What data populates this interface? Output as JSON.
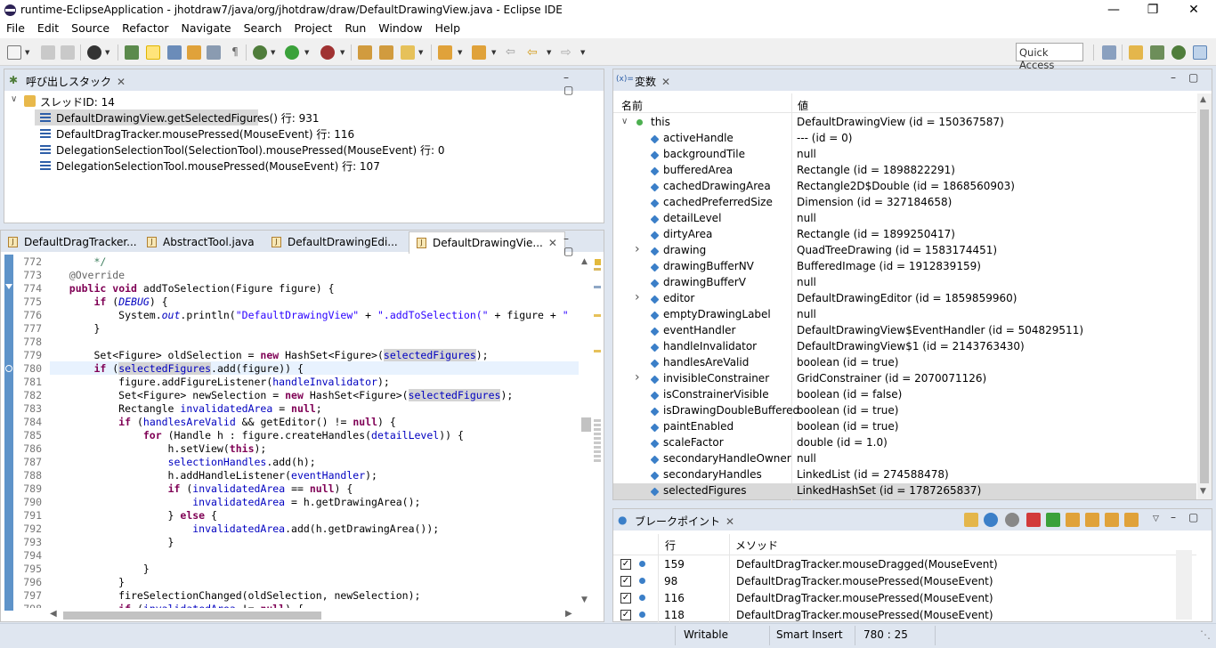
{
  "window": {
    "title": "runtime-EclipseApplication - jhotdraw7/java/org/jhotdraw/draw/DefaultDrawingView.java - Eclipse IDE",
    "minimize": "—",
    "restore": "❐",
    "close": "✕"
  },
  "menu": [
    "File",
    "Edit",
    "Source",
    "Refactor",
    "Navigate",
    "Search",
    "Project",
    "Run",
    "Window",
    "Help"
  ],
  "toolbar": {
    "quick_access": "Quick Access"
  },
  "callstack": {
    "title": "呼び出しスタック",
    "thread": "スレッドID: 14",
    "frames": [
      "DefaultDrawingView.getSelectedFigures() 行: 931",
      "DefaultDragTracker.mousePressed(MouseEvent) 行: 116",
      "DelegationSelectionTool(SelectionTool).mousePressed(MouseEvent) 行: 0",
      "DelegationSelectionTool.mousePressed(MouseEvent) 行: 107"
    ]
  },
  "editor": {
    "tabs": [
      "DefaultDragTracker...",
      "AbstractTool.java",
      "DefaultDrawingEdi...",
      "DefaultDrawingVie..."
    ],
    "lines": [
      {
        "n": "772",
        "html": "    <span class=\"com\">*/</span>"
      },
      {
        "n": "773",
        "html": "<span class=\"ann\">@Override</span>"
      },
      {
        "n": "774",
        "html": "<span class=\"kw\">public</span> <span class=\"kw\">void</span> addToSelection(Figure figure) {"
      },
      {
        "n": "775",
        "html": "    <span class=\"kw\">if</span> (<span class=\"fld\"><i>DEBUG</i></span>) {"
      },
      {
        "n": "776",
        "html": "        System.<span class=\"fld\"><i>out</i></span>.println(<span class=\"str\">\"DefaultDrawingView\"</span> + <span class=\"str\">\".addToSelection(\"</span> + figure + <span class=\"str\">\"</span>"
      },
      {
        "n": "777",
        "html": "    }"
      },
      {
        "n": "778",
        "html": ""
      },
      {
        "n": "779",
        "html": "    Set&lt;Figure&gt; oldSelection = <span class=\"kw\">new</span> HashSet&lt;Figure&gt;(<span class=\"fld hl\">selectedFigures</span>);"
      },
      {
        "n": "780",
        "html": "    <span class=\"kw\">if</span> (<span class=\"fld hl\">selectedFigures</span>.add(figure)) {"
      },
      {
        "n": "781",
        "html": "        figure.addFigureListener(<span class=\"fld\">handleInvalidator</span>);"
      },
      {
        "n": "782",
        "html": "        Set&lt;Figure&gt; newSelection = <span class=\"kw\">new</span> HashSet&lt;Figure&gt;(<span class=\"fld hl\">selectedFigures</span>);"
      },
      {
        "n": "783",
        "html": "        Rectangle <span class=\"fld\">invalidatedArea</span> = <span class=\"kw\">null</span>;"
      },
      {
        "n": "784",
        "html": "        <span class=\"kw\">if</span> (<span class=\"fld\">handlesAreValid</span> &amp;&amp; getEditor() != <span class=\"kw\">null</span>) {"
      },
      {
        "n": "785",
        "html": "            <span class=\"kw\">for</span> (Handle h : figure.createHandles(<span class=\"fld\">detailLevel</span>)) {"
      },
      {
        "n": "786",
        "html": "                h.setView(<span class=\"kw\">this</span>);"
      },
      {
        "n": "787",
        "html": "                <span class=\"fld\">selectionHandles</span>.add(h);"
      },
      {
        "n": "788",
        "html": "                h.addHandleListener(<span class=\"fld\">eventHandler</span>);"
      },
      {
        "n": "789",
        "html": "                <span class=\"kw\">if</span> (<span class=\"fld\">invalidatedArea</span> == <span class=\"kw\">null</span>) {"
      },
      {
        "n": "790",
        "html": "                    <span class=\"fld\">invalidatedArea</span> = h.getDrawingArea();"
      },
      {
        "n": "791",
        "html": "                } <span class=\"kw\">else</span> {"
      },
      {
        "n": "792",
        "html": "                    <span class=\"fld\">invalidatedArea</span>.add(h.getDrawingArea());"
      },
      {
        "n": "793",
        "html": "                }"
      },
      {
        "n": "794",
        "html": ""
      },
      {
        "n": "795",
        "html": "            }"
      },
      {
        "n": "796",
        "html": "        }"
      },
      {
        "n": "797",
        "html": "        fireSelectionChanged(oldSelection, newSelection);"
      },
      {
        "n": "798",
        "html": "        <span class=\"kw\">if</span> (<span class=\"fld\">invalidatedArea</span> != <span class=\"kw\">null</span>) {"
      }
    ]
  },
  "variables": {
    "title": "変数",
    "col_name": "名前",
    "col_value": "値",
    "rows": [
      {
        "name": "this",
        "value": "DefaultDrawingView  (id = 150367587)",
        "expanded": true
      },
      {
        "name": "activeHandle",
        "value": "--- (id = 0)"
      },
      {
        "name": "backgroundTile",
        "value": "null"
      },
      {
        "name": "bufferedArea",
        "value": "Rectangle  (id = 1898822291)"
      },
      {
        "name": "cachedDrawingArea",
        "value": "Rectangle2D$Double  (id = 1868560903)"
      },
      {
        "name": "cachedPreferredSize",
        "value": "Dimension  (id = 327184658)"
      },
      {
        "name": "detailLevel",
        "value": "null"
      },
      {
        "name": "dirtyArea",
        "value": "Rectangle  (id = 1899250417)"
      },
      {
        "name": "drawing",
        "value": "QuadTreeDrawing  (id = 1583174451)",
        "expander": true
      },
      {
        "name": "drawingBufferNV",
        "value": "BufferedImage  (id = 1912839159)"
      },
      {
        "name": "drawingBufferV",
        "value": "null"
      },
      {
        "name": "editor",
        "value": "DefaultDrawingEditor  (id = 1859859960)",
        "expander": true
      },
      {
        "name": "emptyDrawingLabel",
        "value": "null"
      },
      {
        "name": "eventHandler",
        "value": "DefaultDrawingView$EventHandler  (id = 504829511)"
      },
      {
        "name": "handleInvalidator",
        "value": "DefaultDrawingView$1  (id = 2143763430)"
      },
      {
        "name": "handlesAreValid",
        "value": "boolean  (id = true)"
      },
      {
        "name": "invisibleConstrainer",
        "value": "GridConstrainer  (id = 2070071126)",
        "expander": true
      },
      {
        "name": "isConstrainerVisible",
        "value": "boolean  (id = false)"
      },
      {
        "name": "isDrawingDoubleBuffered",
        "value": "boolean  (id = true)"
      },
      {
        "name": "paintEnabled",
        "value": "boolean  (id = true)"
      },
      {
        "name": "scaleFactor",
        "value": "double  (id = 1.0)"
      },
      {
        "name": "secondaryHandleOwner",
        "value": "null"
      },
      {
        "name": "secondaryHandles",
        "value": "LinkedList  (id = 274588478)"
      },
      {
        "name": "selectedFigures",
        "value": "LinkedHashSet  (id = 1787265837)",
        "selected": true
      }
    ]
  },
  "breakpoints": {
    "title": "ブレークポイント",
    "col_line": "行",
    "col_method": "メソッド",
    "rows": [
      {
        "line": "159",
        "method": "DefaultDragTracker.mouseDragged(MouseEvent)"
      },
      {
        "line": "98",
        "method": "DefaultDragTracker.mousePressed(MouseEvent)"
      },
      {
        "line": "116",
        "method": "DefaultDragTracker.mousePressed(MouseEvent)"
      },
      {
        "line": "118",
        "method": "DefaultDragTracker.mousePressed(MouseEvent)"
      }
    ]
  },
  "status": {
    "writable": "Writable",
    "insert": "Smart Insert",
    "position": "780 : 25"
  }
}
